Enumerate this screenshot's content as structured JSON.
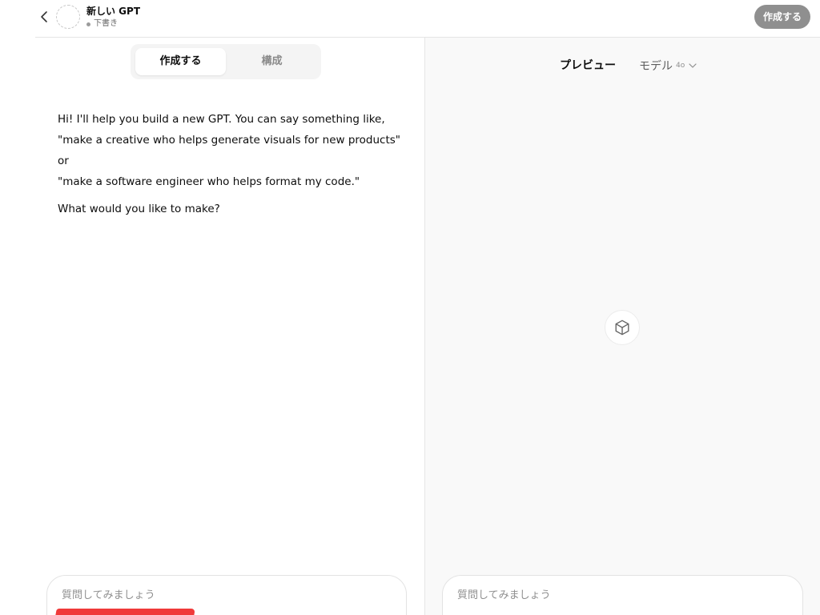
{
  "header": {
    "gpt_name": "新しい GPT",
    "status": "下書き",
    "create_button": "作成する",
    "back_icon": "chevron-left-icon",
    "avatar_icon": "dashed-circle-avatar"
  },
  "left": {
    "tabs": [
      {
        "label": "作成する",
        "active": true
      },
      {
        "label": "構成",
        "active": false
      }
    ],
    "intro_lines": [
      "Hi! I'll help you build a new GPT. You can say something like,",
      "\"make a creative who helps generate visuals for new products\" or",
      "\"make a software engineer who helps format my code.\""
    ],
    "question": "What would you like to make?",
    "composer": {
      "placeholder": "質問してみましょう",
      "value": ""
    }
  },
  "right": {
    "title": "プレビュー",
    "model_label": "モデル",
    "model_value": "4o",
    "center_icon": "cube-icon",
    "composer": {
      "placeholder": "質問してみましょう",
      "value": ""
    }
  },
  "colors": {
    "create_button_bg": "#8f8f8f",
    "preview_bg": "#f9f9f9",
    "annotation_mark": "#f03a3a"
  }
}
